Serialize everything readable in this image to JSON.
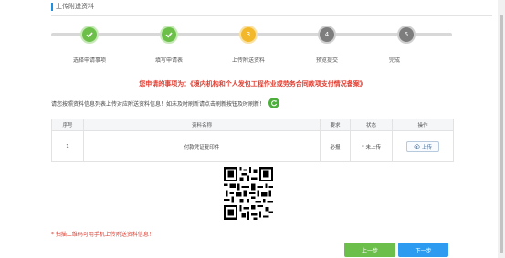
{
  "section": {
    "title": "上传附送资料"
  },
  "steps": [
    {
      "num": "1",
      "label": "选择申请事项",
      "status": "done"
    },
    {
      "num": "2",
      "label": "填写申请表",
      "status": "done"
    },
    {
      "num": "3",
      "label": "上传附送资料",
      "status": "current"
    },
    {
      "num": "4",
      "label": "预览提交",
      "status": "todo"
    },
    {
      "num": "5",
      "label": "完成",
      "status": "todo"
    }
  ],
  "notice": "您申请的事项为：《境内机构和个人发包工程作业或劳务合同款项支付情况备案》",
  "hint": "请您按照资料信息列表上传对应附送资料信息！如未及时刷新请点击刷新按钮及时刷新！",
  "table": {
    "headers": [
      "序号",
      "资料名称",
      "要求",
      "状态",
      "操作"
    ],
    "rows": [
      {
        "index": "1",
        "name": "付款凭证复印件",
        "requirement": "必报",
        "status": "未上传",
        "action": "上传"
      }
    ]
  },
  "tip": "* 扫描二维码可用手机上传附送资料信息！",
  "buttons": {
    "prev": "上一步",
    "next": "下一步"
  },
  "colors": {
    "done": "#6cc04a",
    "current": "#f3b82a",
    "todo": "#7d7d7d",
    "notice": "#e23b2e",
    "prev_btn": "#6cbf4b",
    "next_btn": "#2d9cf0"
  }
}
